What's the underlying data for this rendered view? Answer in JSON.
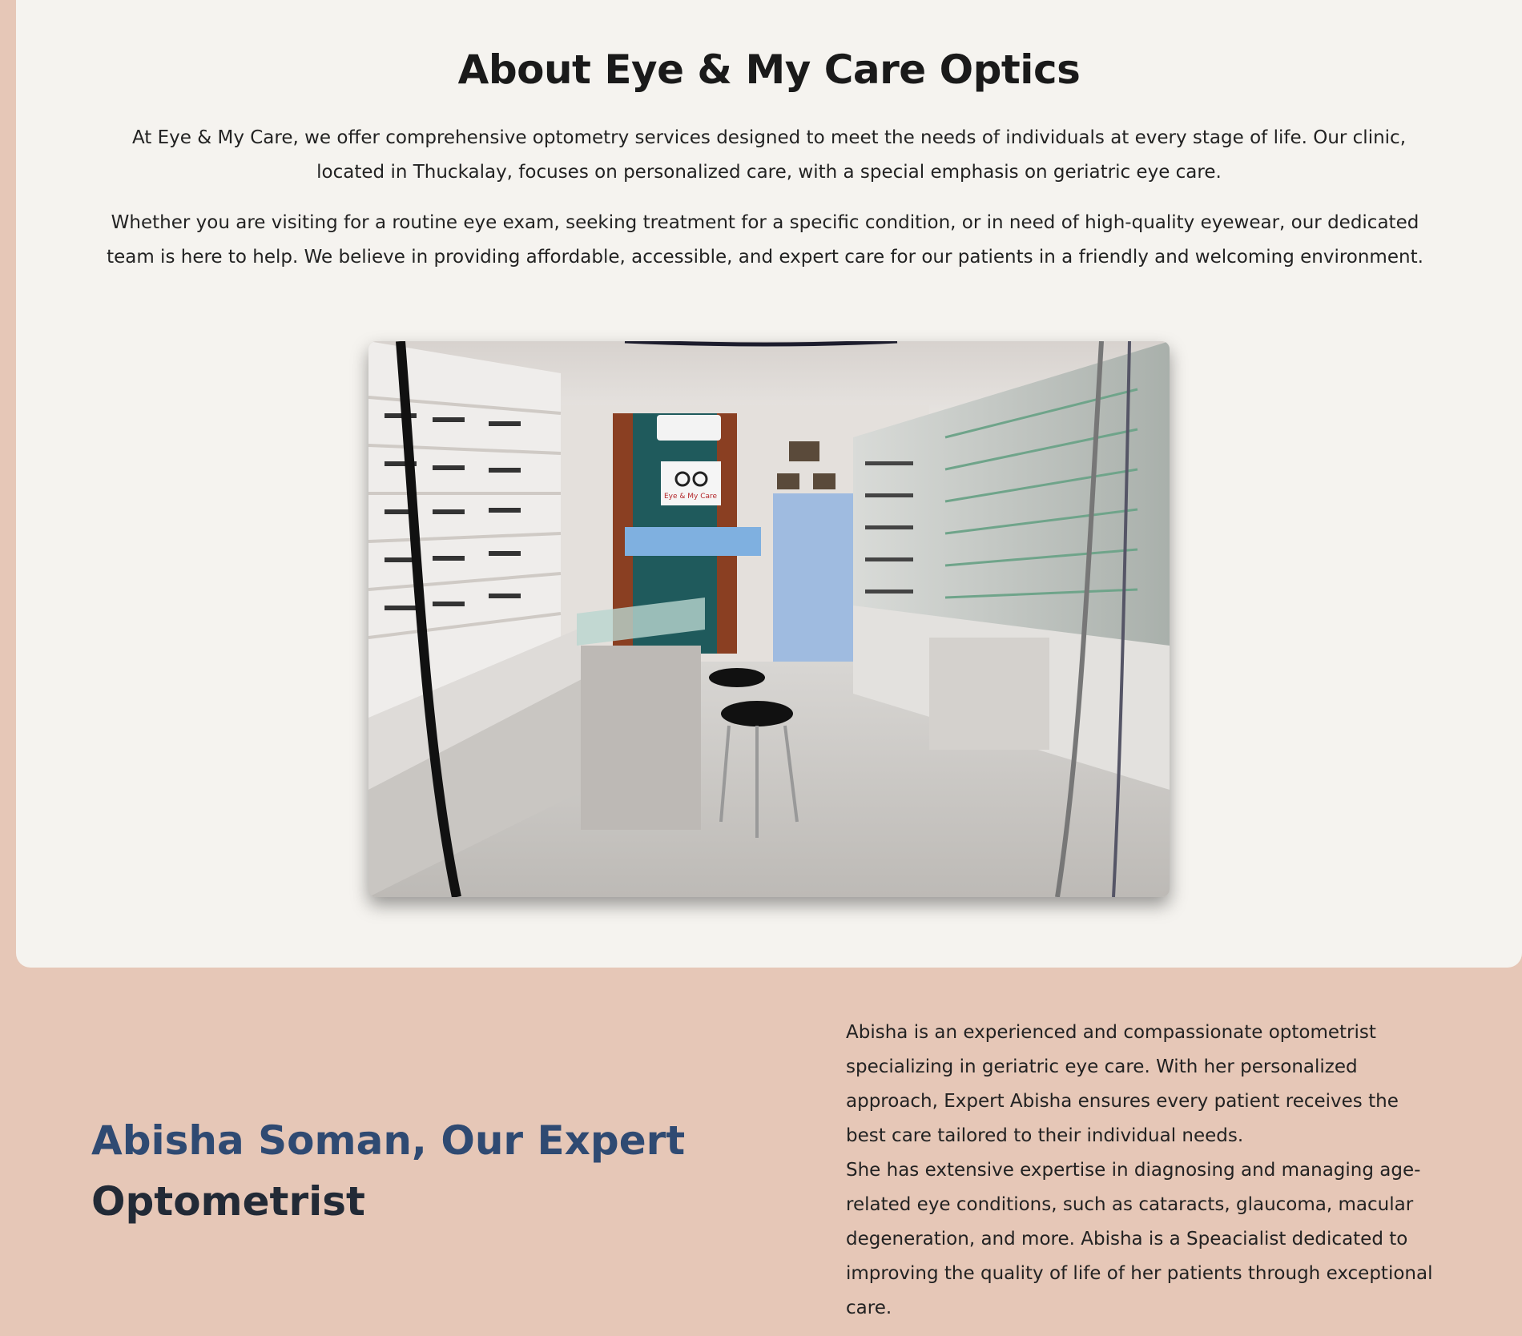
{
  "about": {
    "title": "About Eye & My Care Optics",
    "paragraph1": "At Eye & My Care, we offer comprehensive optometry services designed to meet the needs of individuals at every stage of life. Our clinic, located in Thuckalay, focuses on personalized care, with a special emphasis on geriatric eye care.",
    "paragraph2": "Whether you are visiting for a routine eye exam, seeking treatment for a specific condition, or in need of high-quality eyewear, our dedicated team is here to help. We believe in providing affordable, accessible, and expert care for our patients in a friendly and welcoming environment.",
    "photo_sign_text": "Eye & My Care"
  },
  "expert": {
    "heading_accent": "Abisha Soman, Our Expert",
    "heading_rest": "Optometrist",
    "bio_paragraph1": "Abisha is an experienced and compassionate optometrist specializing in geriatric eye care. With her personalized approach, Expert Abisha ensures every patient receives the best care tailored to their individual needs.",
    "bio_paragraph2": "She has extensive expertise in diagnosing and managing age-related eye conditions, such as cataracts, glaucoma, macular degeneration, and more. Abisha is a Speacialist dedicated to improving the quality of life of her patients through exceptional care."
  },
  "colors": {
    "page_background": "#e6c7b7",
    "card_background": "#f5f3ef",
    "heading_accent": "#2f4a72",
    "heading_dark": "#222a36"
  }
}
